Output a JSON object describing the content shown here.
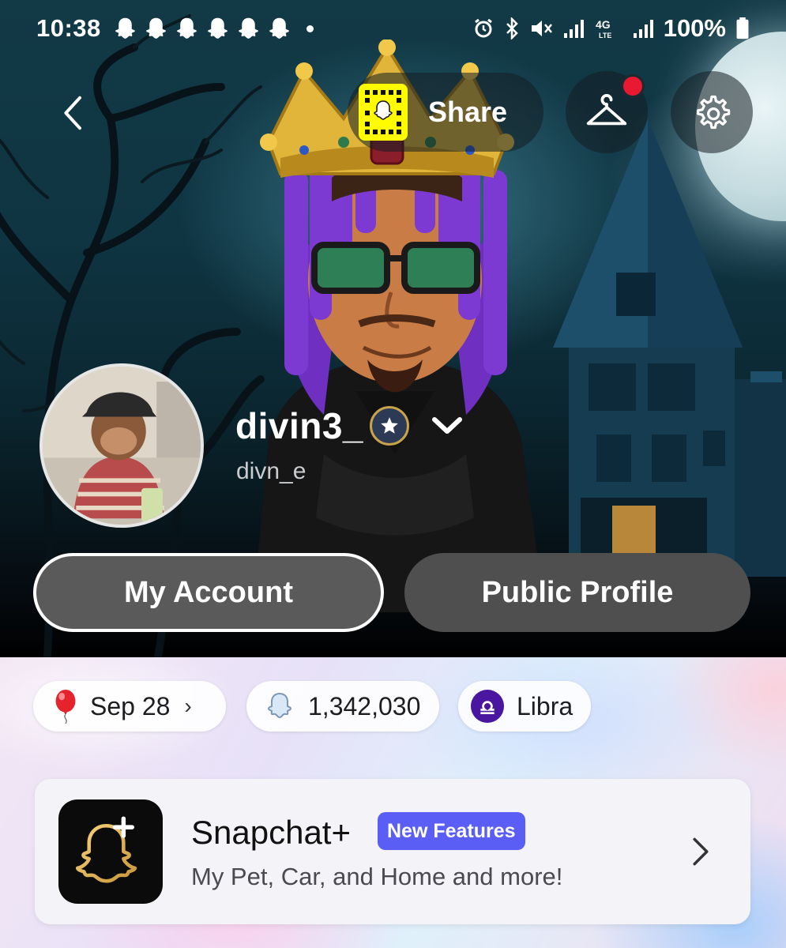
{
  "status_bar": {
    "time": "10:38",
    "network_label": "4G LTE",
    "battery": "100%"
  },
  "top_bar": {
    "share_label": "Share"
  },
  "profile": {
    "display_name": "divin3_",
    "username": "divn_e"
  },
  "buttons": {
    "my_account": "My Account",
    "public_profile": "Public Profile"
  },
  "chips": {
    "birthday": "Sep 28",
    "birthday_chevron": "›",
    "snap_score": "1,342,030",
    "zodiac": "Libra"
  },
  "snapchat_plus": {
    "title": "Snapchat+",
    "badge": "New Features",
    "subtitle": "My Pet, Car, and Home and more!"
  },
  "icons": {
    "back": "chevron-left-icon",
    "wardrobe": "hanger-icon",
    "settings": "gear-icon",
    "birthday": "balloon-icon",
    "score": "ghost-icon",
    "zodiac": "libra-icon"
  },
  "colors": {
    "snap_yellow": "#fffc00",
    "notification_red": "#e81931",
    "badge_purple": "#5b5ef5",
    "zodiac_purple": "#4a16a0",
    "button_gray": "#5a5a5a"
  }
}
